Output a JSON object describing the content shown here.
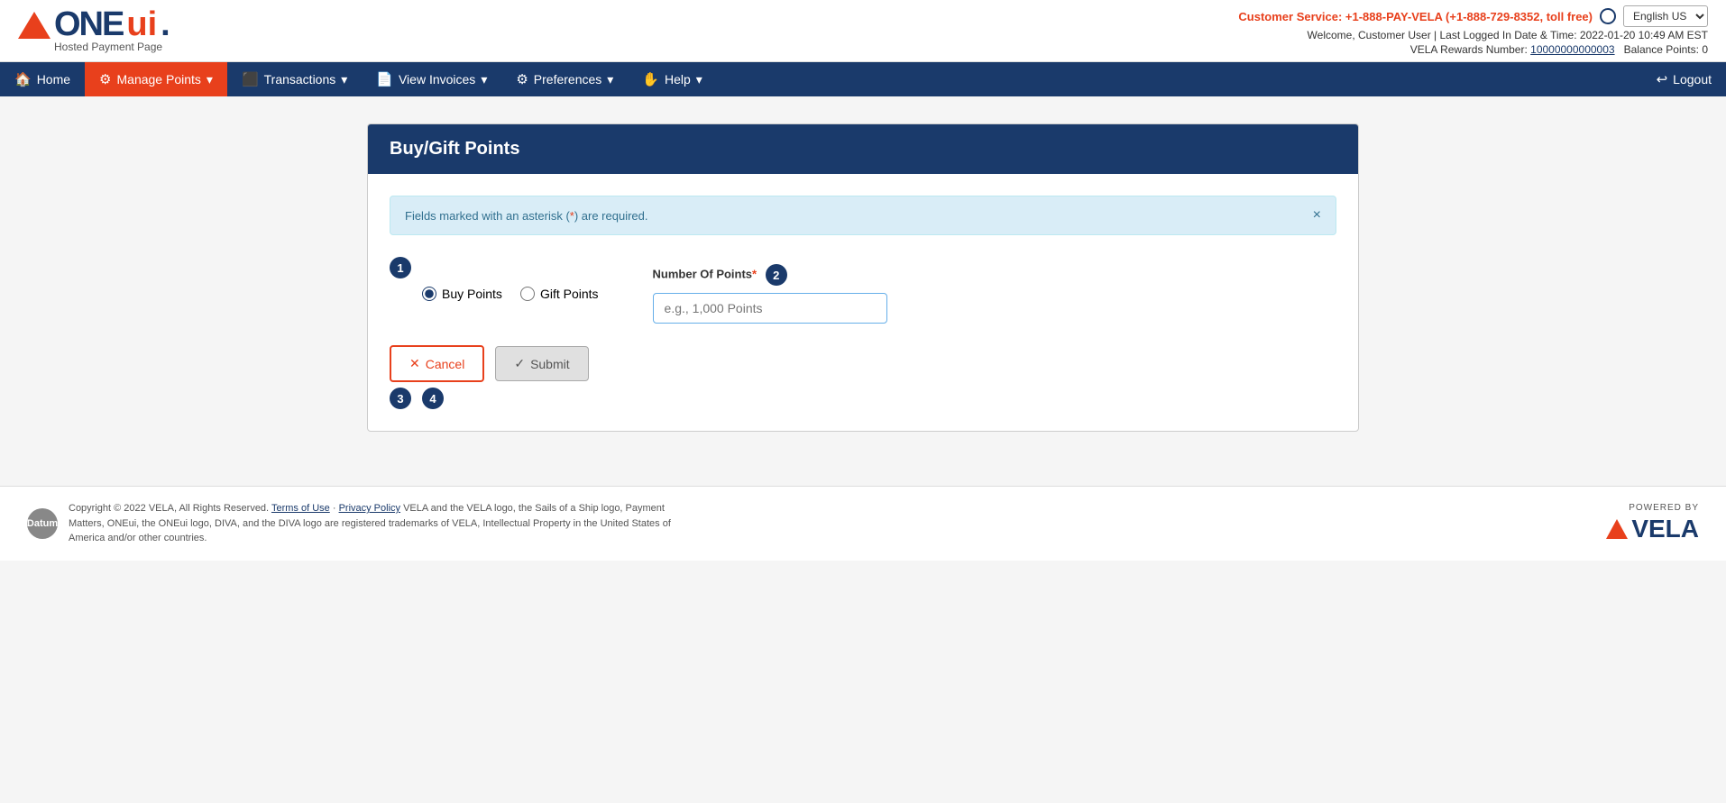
{
  "header": {
    "logo_one": "ONE",
    "logo_ui": "ui",
    "logo_dot": ".",
    "logo_subtitle": "Hosted Payment Page",
    "customer_service_label": "Customer Service: +1-888-PAY-VELA (+1-888-729-8352, toll free)",
    "language": "English US",
    "welcome_text": "Welcome, Customer User  |  Last Logged In Date & Time: 2022-01-20 10:49 AM EST",
    "rewards_label": "VELA Rewards Number:",
    "rewards_number": "10000000000003",
    "balance_label": "Balance Points: 0"
  },
  "navbar": {
    "home": "Home",
    "manage_points": "Manage Points",
    "transactions": "Transactions",
    "view_invoices": "View Invoices",
    "preferences": "Preferences",
    "help": "Help",
    "logout": "Logout"
  },
  "page": {
    "title": "Buy/Gift Points",
    "alert_text": "Fields marked with an asterisk (",
    "alert_asterisk": "*",
    "alert_text2": ") are required.",
    "step1_badge": "1",
    "radio_buy": "Buy Points",
    "radio_gift": "Gift Points",
    "field_label": "Number Of Points",
    "field_required": "*",
    "step2_badge": "2",
    "input_placeholder": "e.g., 1,000 Points",
    "cancel_label": "Cancel",
    "submit_label": "Submit",
    "step3_badge": "3",
    "step4_badge": "4"
  },
  "footer": {
    "copyright": "Copyright © 2022 VELA, All Rights Reserved.",
    "terms": "Terms of Use",
    "separator": "·",
    "privacy": "Privacy Policy",
    "description": " VELA and the VELA logo, the Sails of a Ship logo, Payment Matters, ONEui, the ONEui logo, DIVA, and the DIVA logo are registered trademarks of VELA, Intellectual Property in the United States of America and/or other countries.",
    "powered_by": "POWERED BY",
    "vela": "VELA",
    "datum": "Datum"
  }
}
